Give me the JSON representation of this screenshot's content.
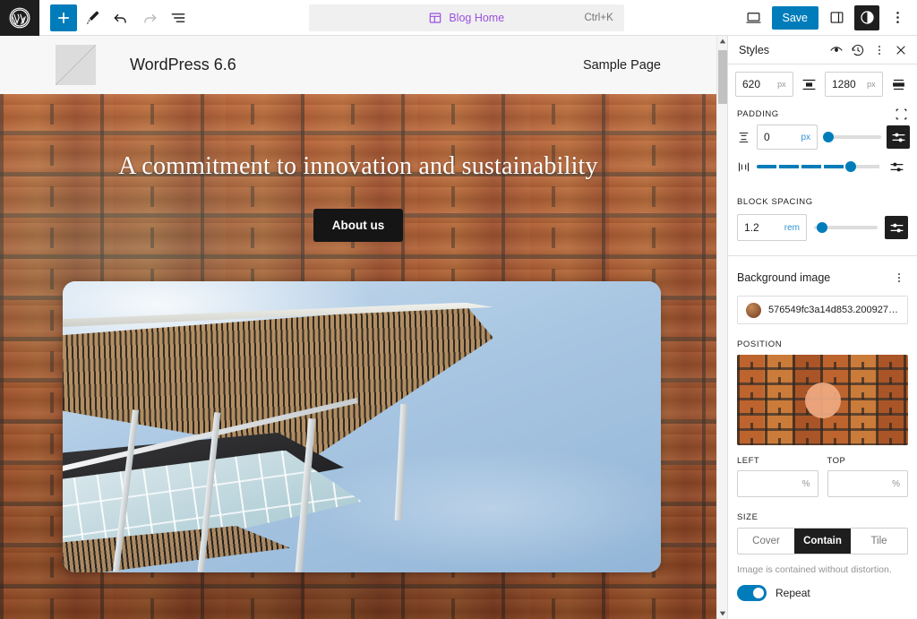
{
  "topbar": {
    "logo_icon": "wordpress-logo-icon",
    "add_block_label": "+",
    "tools": [
      {
        "name": "add-block-button",
        "icon": "plus-icon"
      },
      {
        "name": "edit-tool-button",
        "icon": "pencil-icon"
      },
      {
        "name": "undo-button",
        "icon": "undo-arrow-icon"
      },
      {
        "name": "redo-button",
        "icon": "redo-arrow-icon"
      },
      {
        "name": "list-view-button",
        "icon": "document-overview-icon"
      }
    ],
    "command_bar": {
      "icon": "template-layout-icon",
      "label": "Blog Home",
      "shortcut": "Ctrl+K"
    },
    "preview_icon": "desktop-preview-icon",
    "save_label": "Save",
    "settings_icon": "settings-sidebar-icon",
    "styles_icon": "styles-contrast-icon",
    "options_icon": "more-options-icon"
  },
  "site": {
    "logo_icon": "site-logo-placeholder",
    "title": "WordPress 6.6",
    "nav_item": "Sample Page"
  },
  "hero": {
    "heading": "A commitment to innovation and sustainability",
    "button_label": "About us"
  },
  "content": {
    "image_alt": "modern architecture canopy against blue sky"
  },
  "sidebar": {
    "title": "Styles",
    "header_icons": [
      {
        "name": "style-book-icon",
        "icon": "eye-icon"
      },
      {
        "name": "revisions-icon",
        "icon": "clock-history-icon"
      },
      {
        "name": "more-menu-icon",
        "icon": "three-dots-vertical-icon"
      },
      {
        "name": "close-panel-icon",
        "icon": "close-x-icon"
      }
    ],
    "width": {
      "content_value": "620",
      "content_unit": "px",
      "content_align_icon": "align-content-width-icon",
      "wide_value": "1280",
      "wide_unit": "px",
      "wide_align_icon": "align-wide-width-icon"
    },
    "padding": {
      "label": "PADDING",
      "link_sides_icon": "link-sides-icon",
      "vertical": {
        "side_icon": "vertical-sides-icon",
        "value": "0",
        "unit": "px",
        "slider_percent": 2,
        "settings_icon": "sliders-settings-icon"
      },
      "horizontal": {
        "side_icon": "horizontal-sides-icon",
        "slider_percent": 70,
        "settings_icon": "sliders-settings-icon"
      }
    },
    "block_spacing": {
      "label": "BLOCK SPACING",
      "value": "1.2",
      "unit": "rem",
      "slider_percent": 10,
      "settings_icon": "sliders-settings-icon"
    },
    "background_image": {
      "label": "Background image",
      "menu_icon": "three-dots-vertical-icon",
      "file_name": "576549fc3a14d853.20092773...",
      "position_label": "POSITION",
      "position_handle": "position-drag-handle",
      "left_label": "LEFT",
      "left_value": "",
      "left_unit": "%",
      "top_label": "TOP",
      "top_value": "",
      "top_unit": "%",
      "size_label": "SIZE",
      "size_options": [
        "Cover",
        "Contain",
        "Tile"
      ],
      "size_selected": "Contain",
      "size_help": "Image is contained without distortion.",
      "repeat_label": "Repeat",
      "repeat_on": true
    }
  },
  "colors": {
    "accent": "#007cba",
    "command_purple": "#9b51e0",
    "dark": "#1e1e1e"
  }
}
